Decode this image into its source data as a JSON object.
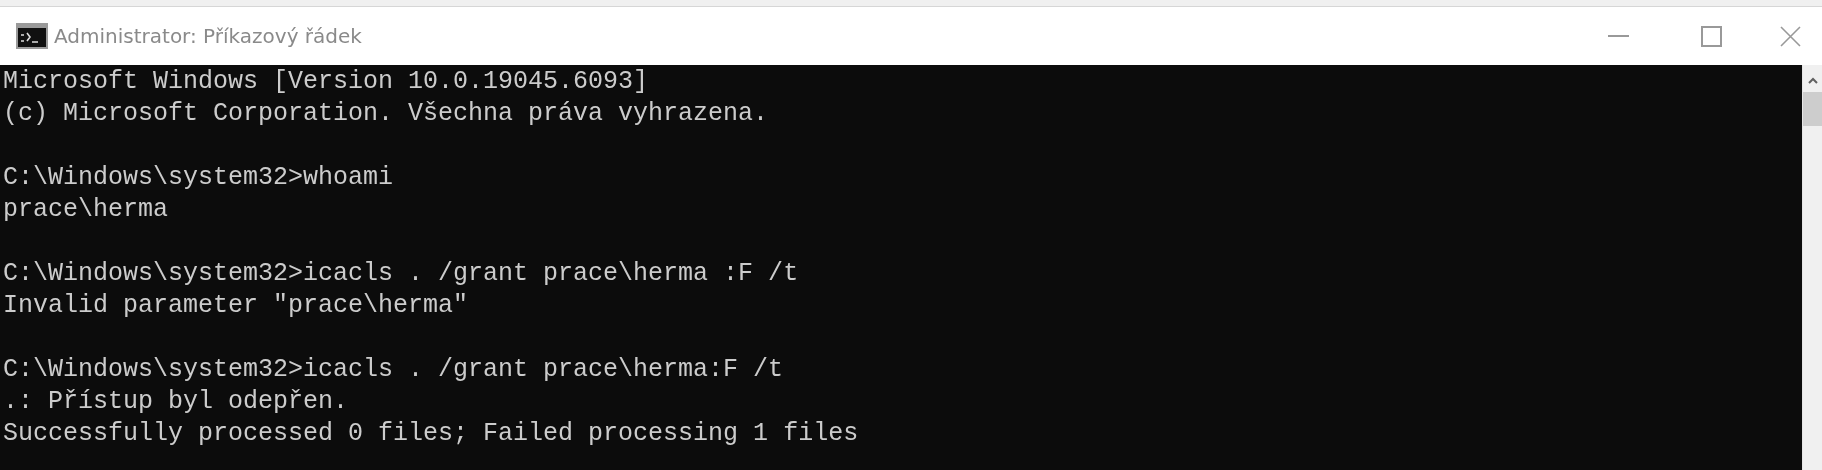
{
  "window": {
    "title": "Administrator: Příkazový řádek"
  },
  "console": {
    "blocks": [
      [
        "Microsoft Windows [Version 10.0.19045.6093]",
        "(c) Microsoft Corporation. Všechna práva vyhrazena."
      ],
      [
        "C:\\Windows\\system32>whoami",
        "prace\\herma"
      ],
      [
        "C:\\Windows\\system32>icacls . /grant prace\\herma :F /t",
        "Invalid parameter \"prace\\herma\""
      ],
      [
        "C:\\Windows\\system32>icacls . /grant prace\\herma:F /t",
        ".: Přístup byl odepřen.",
        "Successfully processed 0 files; Failed processing 1 files"
      ]
    ]
  }
}
